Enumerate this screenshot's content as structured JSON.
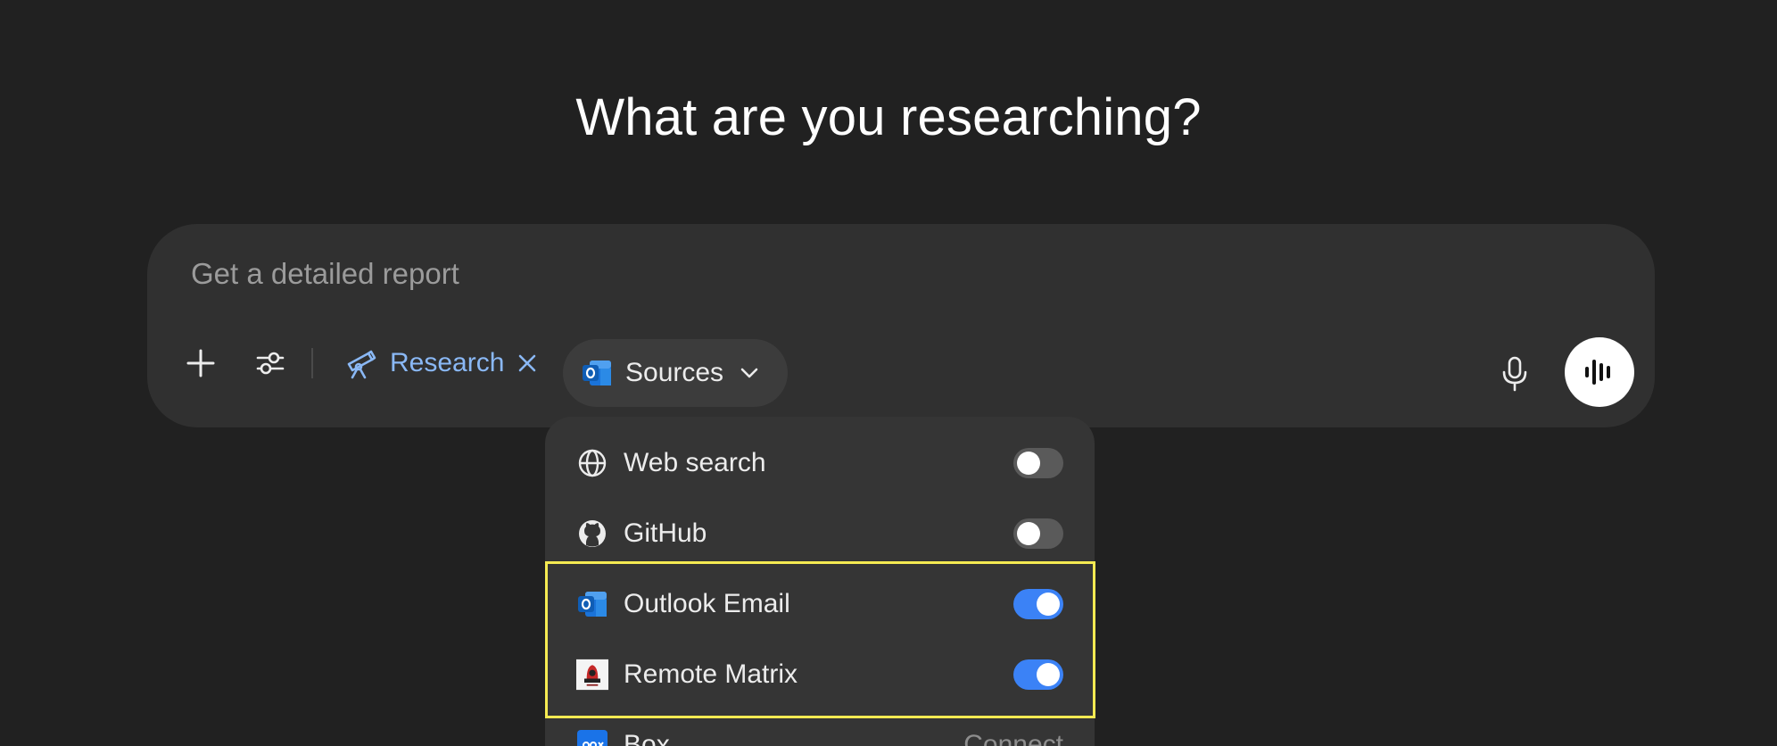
{
  "page": {
    "title": "What are you researching?"
  },
  "composer": {
    "placeholder": "Get a detailed report",
    "research_label": "Research",
    "sources_label": "Sources"
  },
  "sources_menu": {
    "items": [
      {
        "label": "Web search",
        "icon": "globe-icon",
        "enabled": false
      },
      {
        "label": "GitHub",
        "icon": "github-icon",
        "enabled": false
      },
      {
        "label": "Outlook Email",
        "icon": "outlook-icon",
        "enabled": true
      },
      {
        "label": "Remote Matrix",
        "icon": "remote-matrix-icon",
        "enabled": true
      },
      {
        "label": "Box",
        "icon": "box-icon",
        "action": "Connect"
      }
    ]
  },
  "colors": {
    "background": "#212121",
    "composer": "#303030",
    "accent_blue": "#3b82f6",
    "research_chip": "#8ab8f5",
    "highlight": "#f5ea52"
  }
}
